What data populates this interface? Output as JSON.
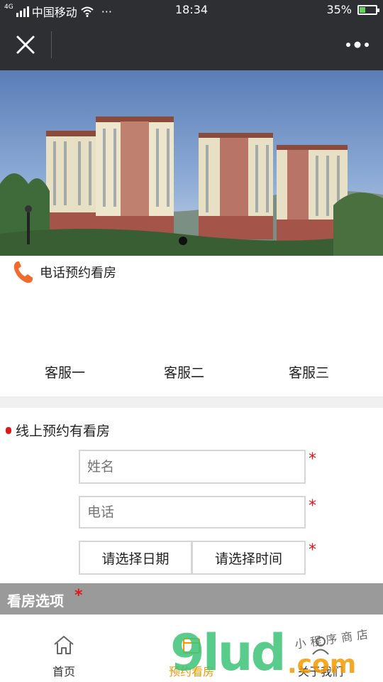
{
  "status_bar": {
    "carrier": "中国移动",
    "network": "4G",
    "ellipsis": "···",
    "time": "18:34",
    "battery": "35%",
    "battery_level": 0.35
  },
  "nav": {
    "close_icon": "close-icon",
    "more_icon": "more-dots-icon"
  },
  "banner": {
    "image": "apartment-buildings-photo",
    "page_count": 1
  },
  "phone_section": {
    "title": "电话预约看房",
    "icon": "phone-icon",
    "buttons": [
      "客服一",
      "客服二",
      "客服三"
    ]
  },
  "online_section": {
    "title": "线上预约有看房",
    "name_placeholder": "姓名",
    "phone_placeholder": "电话",
    "date_button": "请选择日期",
    "time_button": "请选择时间",
    "required_mark": "*"
  },
  "options": {
    "title": "看房选项",
    "required_mark": "*"
  },
  "tabbar": {
    "tabs": [
      {
        "label": "首页",
        "icon": "home-icon",
        "active": false
      },
      {
        "label": "预约看房",
        "icon": "calendar-icon",
        "active": true
      },
      {
        "label": "关于我们",
        "icon": "user-icon",
        "active": false
      }
    ]
  },
  "watermark": {
    "brand": "9lud",
    "suffix": ".com",
    "tagline": "小程序商店"
  },
  "colors": {
    "status_bg": "#2e2f33",
    "required": "#e01818",
    "active_tab": "#f39800",
    "phone_icon": "#f26a2e",
    "options_bar": "#9a9a9a",
    "divider": "#f0f0f0"
  }
}
